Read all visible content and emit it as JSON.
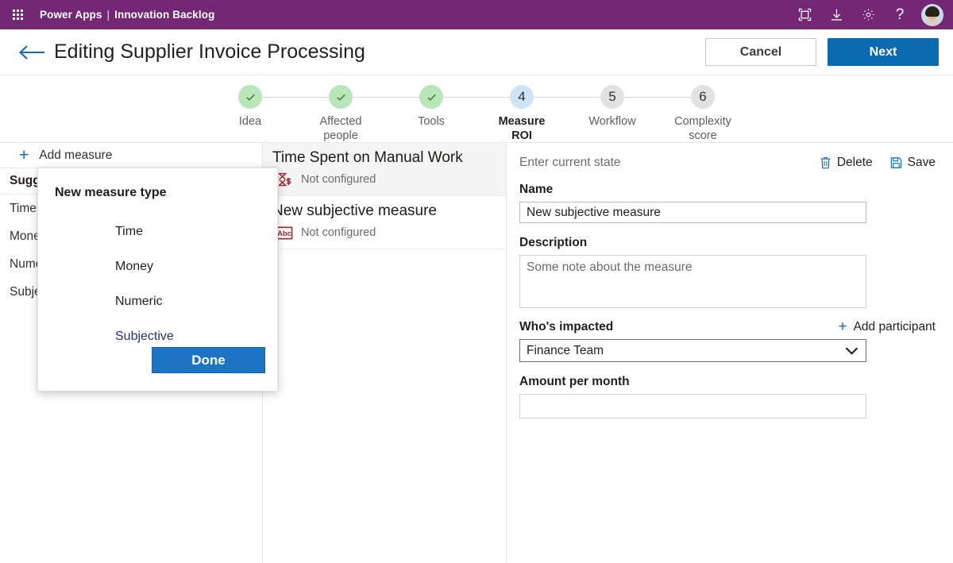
{
  "suitebar": {
    "waffle_icon": "app-launcher-icon",
    "app_name": "Power Apps",
    "separator": "|",
    "environment": "Innovation Backlog",
    "icons": [
      {
        "name": "fullscreen-icon",
        "label": "Fullscreen"
      },
      {
        "name": "download-icon",
        "label": "Download"
      },
      {
        "name": "gear-icon",
        "label": "Settings"
      },
      {
        "name": "help-icon",
        "label": "?"
      }
    ],
    "avatar_label": "User account"
  },
  "header": {
    "back_icon": "back-arrow-icon",
    "title": "Editing Supplier Invoice Processing",
    "cancel_label": "Cancel",
    "next_label": "Next"
  },
  "stepper": {
    "steps": [
      {
        "number": "1",
        "label": "Idea",
        "state": "done"
      },
      {
        "number": "2",
        "label": "Affected\npeople",
        "state": "done"
      },
      {
        "number": "3",
        "label": "Tools",
        "state": "done"
      },
      {
        "number": "4",
        "label": "Measure\nROI",
        "state": "active"
      },
      {
        "number": "5",
        "label": "Workflow",
        "state": "inactive"
      },
      {
        "number": "6",
        "label": "Complexity\nscore",
        "state": "inactive"
      }
    ]
  },
  "left_panel": {
    "add_measure_label": "Add measure",
    "section_title": "Suggested measures",
    "items": [
      {
        "label": "Time"
      },
      {
        "label": "Money"
      },
      {
        "label": "Numeric"
      },
      {
        "label": "Subjective"
      }
    ]
  },
  "measure_list": {
    "cards": [
      {
        "title": "Time Spent on Manual Work",
        "status": "Not configured",
        "icon": "hourglass-money-icon",
        "selected": true
      },
      {
        "title": "New subjective measure",
        "status": "Not configured",
        "icon": "abc-text-icon",
        "selected": false
      }
    ]
  },
  "detail_panel": {
    "state_label": "Enter current state",
    "delete_label": "Delete",
    "delete_icon": "trash-icon",
    "save_label": "Save",
    "save_icon": "save-disk-icon",
    "name_label": "Name",
    "name_value": "New subjective measure",
    "description_label": "Description",
    "description_value": "",
    "description_placeholder": "Some note about the measure",
    "impacted_label": "Who's impacted",
    "add_participant_label": "Add participant",
    "add_participant_icon": "plus-icon",
    "impacted_value": "Finance Team",
    "impacted_chevron": "chevron-down-icon",
    "amount_label": "Amount per month",
    "amount_value": ""
  },
  "flyout": {
    "title": "New measure type",
    "options": [
      {
        "label": "Time",
        "selected": false
      },
      {
        "label": "Money",
        "selected": false
      },
      {
        "label": "Numeric",
        "selected": false
      },
      {
        "label": "Subjective",
        "selected": true
      }
    ],
    "done_label": "Done"
  },
  "colors": {
    "suitebar_purple": "#742774",
    "primary_blue": "#0b6ab0",
    "link_blue": "#0f6cbd",
    "step_done_green": "#b9e6b9",
    "step_active_blue": "#cde4f7",
    "measure_icon_red": "#a4262c",
    "selected_option_navy": "#20337a"
  }
}
